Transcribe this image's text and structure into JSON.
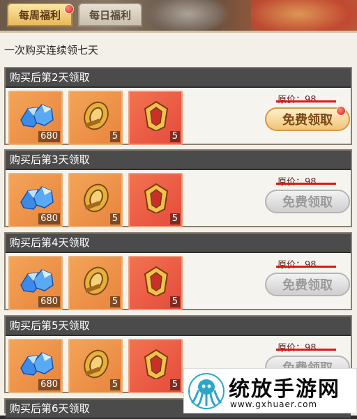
{
  "tabs": [
    {
      "label": "每周福利",
      "active": true,
      "badge": true
    },
    {
      "label": "每日福利",
      "active": false,
      "badge": false
    }
  ],
  "subtitle": "一次购买连续领七天",
  "colors": {
    "accent": "#e01c10",
    "header": "#4b4b4b",
    "strike": "#d81a12"
  },
  "rows": [
    {
      "title": "购买后第2天领取",
      "price_label": "原价：98",
      "claim_label": "免费领取",
      "claim_enabled": true,
      "claim_badge": true,
      "items": [
        {
          "icon": "blue-gem-icon",
          "count": "680"
        },
        {
          "icon": "gold-ring-icon",
          "count": "5"
        },
        {
          "icon": "gold-emblem-icon",
          "count": "5"
        }
      ]
    },
    {
      "title": "购买后第3天领取",
      "price_label": "原价：98",
      "claim_label": "免费领取",
      "claim_enabled": false,
      "claim_badge": false,
      "items": [
        {
          "icon": "blue-gem-icon",
          "count": "680"
        },
        {
          "icon": "gold-ring-icon",
          "count": "5"
        },
        {
          "icon": "gold-emblem-icon",
          "count": "5"
        }
      ]
    },
    {
      "title": "购买后第4天领取",
      "price_label": "原价：98",
      "claim_label": "免费领取",
      "claim_enabled": false,
      "claim_badge": false,
      "items": [
        {
          "icon": "blue-gem-icon",
          "count": "680"
        },
        {
          "icon": "gold-ring-icon",
          "count": "5"
        },
        {
          "icon": "gold-emblem-icon",
          "count": "5"
        }
      ]
    },
    {
      "title": "购买后第5天领取",
      "price_label": "原价：98",
      "claim_label": "免费领取",
      "claim_enabled": false,
      "claim_badge": false,
      "items": [
        {
          "icon": "blue-gem-icon",
          "count": "680"
        },
        {
          "icon": "gold-ring-icon",
          "count": "5"
        },
        {
          "icon": "gold-emblem-icon",
          "count": "5"
        }
      ]
    },
    {
      "title": "购买后第6天领取"
    }
  ],
  "watermark": {
    "name": "统放手游网",
    "url": "www.gxhuaer.com"
  }
}
